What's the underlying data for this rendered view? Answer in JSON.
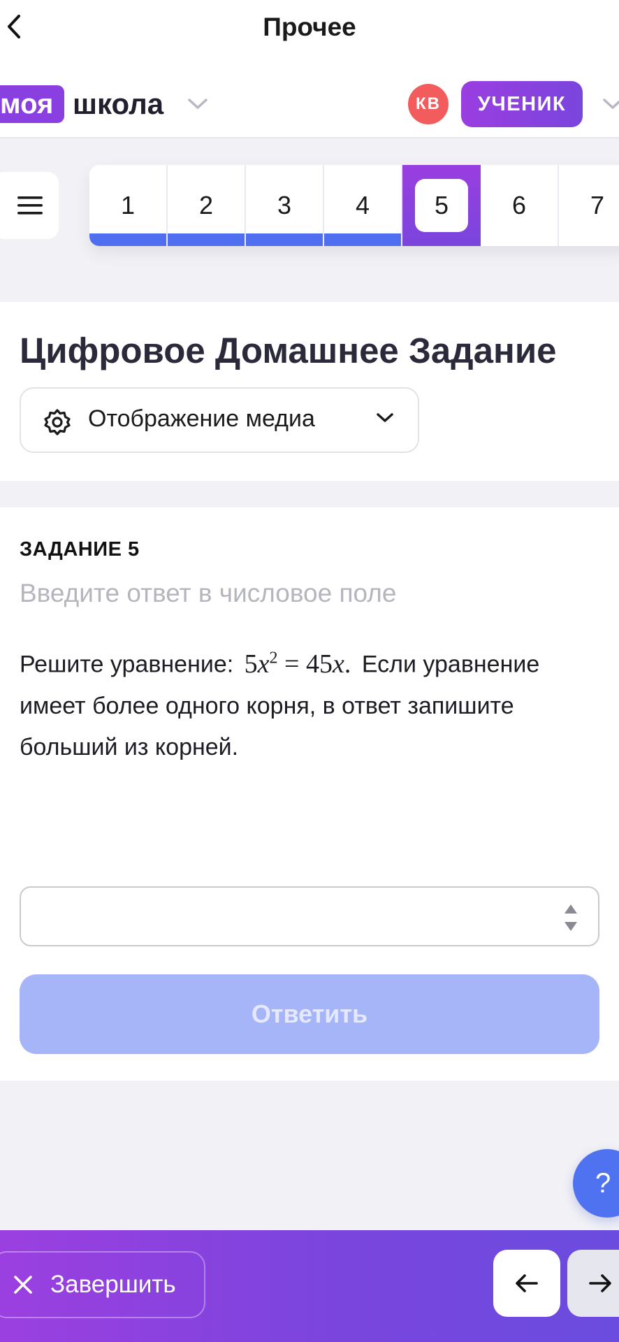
{
  "topnav": {
    "title": "Прочее"
  },
  "header": {
    "logo_badge": "моя",
    "logo_text": "школа",
    "avatar_initials": "КВ",
    "role": "УЧЕНИК"
  },
  "tasks": {
    "tabs": [
      {
        "label": "1",
        "answered": true
      },
      {
        "label": "2",
        "answered": true
      },
      {
        "label": "3",
        "answered": true
      },
      {
        "label": "4",
        "answered": true
      },
      {
        "label": "5",
        "active": true
      },
      {
        "label": "6",
        "answered": false
      },
      {
        "label": "7",
        "answered": false
      }
    ]
  },
  "card": {
    "title": "Цифровое Домашнее Задание",
    "media_select_label": "Отображение медиа"
  },
  "task": {
    "label": "ЗАДАНИЕ 5",
    "hint": "Введите ответ в числовое поле",
    "text_before": "Решите уравнение:",
    "text_after": "Если уравнение имеет более одного корня, в ответ запишите больший из корней.",
    "answer_value": "",
    "submit_label": "Ответить"
  },
  "help": {
    "label": "?"
  },
  "bottombar": {
    "finish_label": "Завершить"
  },
  "colors": {
    "accent_purple": "#8a3fe0",
    "progress_blue": "#4f6ff0",
    "submit_disabled": "#a6b4f8",
    "avatar_red": "#f25c5c"
  }
}
